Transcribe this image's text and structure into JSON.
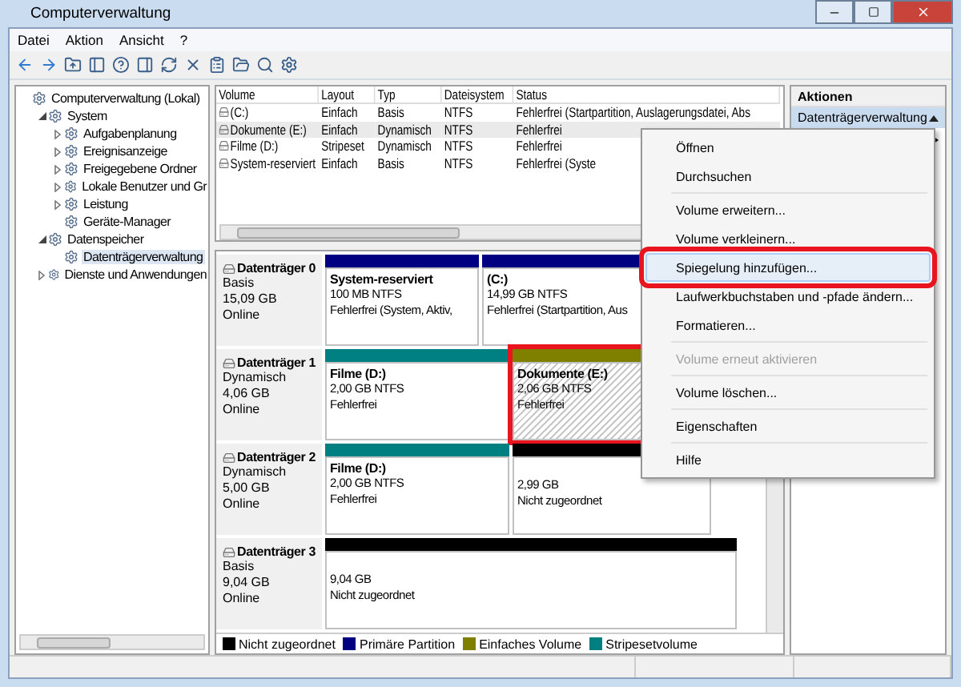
{
  "window": {
    "title": "Computerverwaltung"
  },
  "menu": [
    "Datei",
    "Aktion",
    "Ansicht",
    "?"
  ],
  "tree": [
    {
      "label": "Computerverwaltung (Lokal)",
      "selected": false,
      "children": [
        {
          "label": "System",
          "expanded": true,
          "selected": false,
          "children": [
            {
              "label": "Aufgabenplanung",
              "expanded": false,
              "selected": false
            },
            {
              "label": "Ereignisanzeige",
              "expanded": false,
              "selected": false
            },
            {
              "label": "Freigegebene Ordner",
              "expanded": false,
              "selected": false
            },
            {
              "label": "Lokale Benutzer und Gr",
              "expanded": false,
              "selected": false
            },
            {
              "label": "Leistung",
              "expanded": false,
              "selected": false
            },
            {
              "label": "Geräte-Manager",
              "selected": false
            }
          ]
        },
        {
          "label": "Datenspeicher",
          "expanded": true,
          "selected": false,
          "children": [
            {
              "label": "Datenträgerverwaltung",
              "selected": true
            }
          ]
        },
        {
          "label": "Dienste und Anwendungen",
          "expanded": false,
          "selected": false
        }
      ]
    }
  ],
  "table": {
    "columns": [
      "Volume",
      "Layout",
      "Typ",
      "Dateisystem",
      "Status"
    ],
    "rows": [
      {
        "selected": false,
        "cells": [
          "(C:)",
          "Einfach",
          "Basis",
          "NTFS",
          "Fehlerfrei (Startpartition, Auslagerungsdatei, Abs"
        ]
      },
      {
        "selected": true,
        "cells": [
          "Dokumente (E:)",
          "Einfach",
          "Dynamisch",
          "NTFS",
          "Fehlerfrei"
        ]
      },
      {
        "selected": false,
        "cells": [
          "Filme (D:)",
          "Stripeset",
          "Dynamisch",
          "NTFS",
          "Fehlerfrei"
        ]
      },
      {
        "selected": false,
        "cells": [
          "System-reserviert",
          "Einfach",
          "Basis",
          "NTFS",
          "Fehlerfrei (Syste"
        ]
      }
    ]
  },
  "disks": [
    {
      "name": "Datenträger 0",
      "type": "Basis",
      "size": "15,09 GB",
      "status": "Online",
      "partitions": [
        {
          "kind": "primary",
          "name": "System-reserviert",
          "size": "100 MB NTFS",
          "status": "Fehlerfrei (System, Aktiv,",
          "selected": false,
          "annotated": false
        },
        {
          "kind": "primary",
          "name": "(C:)",
          "size": "14,99 GB NTFS",
          "status": "Fehlerfrei (Startpartition, Aus",
          "selected": false,
          "annotated": false
        }
      ]
    },
    {
      "name": "Datenträger 1",
      "type": "Dynamisch",
      "size": "4,06 GB",
      "status": "Online",
      "partitions": [
        {
          "kind": "stripeset",
          "name": "Filme  (D:)",
          "size": "2,00 GB NTFS",
          "status": "Fehlerfrei",
          "selected": false,
          "annotated": false
        },
        {
          "kind": "simple",
          "name": "Dokumente  (E:)",
          "size": "2,06 GB NTFS",
          "status": "Fehlerfrei",
          "selected": true,
          "annotated": true
        }
      ]
    },
    {
      "name": "Datenträger 2",
      "type": "Dynamisch",
      "size": "5,00 GB",
      "status": "Online",
      "partitions": [
        {
          "kind": "stripeset",
          "name": "Filme  (D:)",
          "size": "2,00 GB NTFS",
          "status": "Fehlerfrei",
          "selected": false,
          "annotated": false
        },
        {
          "kind": "unallocated",
          "size": "2,99 GB",
          "status": "Nicht zugeordnet",
          "selected": false,
          "annotated": false
        }
      ]
    },
    {
      "name": "Datenträger 3",
      "type": "Basis",
      "size": "9,04 GB",
      "status": "Online",
      "partitions": [
        {
          "kind": "unallocated",
          "size": "9,04 GB",
          "status": "Nicht zugeordnet",
          "selected": false,
          "annotated": false
        }
      ]
    }
  ],
  "legend": [
    {
      "label": "Nicht zugeordnet",
      "color": "#000000"
    },
    {
      "label": "Primäre Partition",
      "color": "#000080"
    },
    {
      "label": "Einfaches Volume",
      "color": "#808000"
    },
    {
      "label": "Stripesetvolume",
      "color": "#008080"
    }
  ],
  "actions": {
    "title": "Aktionen",
    "group": {
      "label": "Datenträgerverwaltung",
      "expanded": true
    }
  },
  "context_menu": [
    {
      "kind": "item",
      "label": "Öffnen",
      "disabled": false,
      "selected": false,
      "annotated": false
    },
    {
      "kind": "item",
      "label": "Durchsuchen",
      "disabled": false,
      "selected": false,
      "annotated": false
    },
    {
      "kind": "separator"
    },
    {
      "kind": "item",
      "label": "Volume erweitern...",
      "disabled": false,
      "selected": false,
      "annotated": false
    },
    {
      "kind": "item",
      "label": "Volume verkleinern...",
      "disabled": false,
      "selected": false,
      "annotated": false
    },
    {
      "kind": "item",
      "label": "Spiegelung hinzufügen...",
      "disabled": false,
      "selected": true,
      "annotated": true
    },
    {
      "kind": "item",
      "label": "Laufwerkbuchstaben und -pfade ändern...",
      "disabled": false,
      "selected": false,
      "annotated": false
    },
    {
      "kind": "item",
      "label": "Formatieren...",
      "disabled": false,
      "selected": false,
      "annotated": false
    },
    {
      "kind": "separator"
    },
    {
      "kind": "item",
      "label": "Volume erneut aktivieren",
      "disabled": true,
      "selected": false,
      "annotated": false
    },
    {
      "kind": "separator"
    },
    {
      "kind": "item",
      "label": "Volume löschen...",
      "disabled": false,
      "selected": false,
      "annotated": false
    },
    {
      "kind": "separator"
    },
    {
      "kind": "item",
      "label": "Eigenschaften",
      "disabled": false,
      "selected": false,
      "annotated": false
    },
    {
      "kind": "separator"
    },
    {
      "kind": "item",
      "label": "Hilfe",
      "disabled": false,
      "selected": false,
      "annotated": false
    }
  ]
}
